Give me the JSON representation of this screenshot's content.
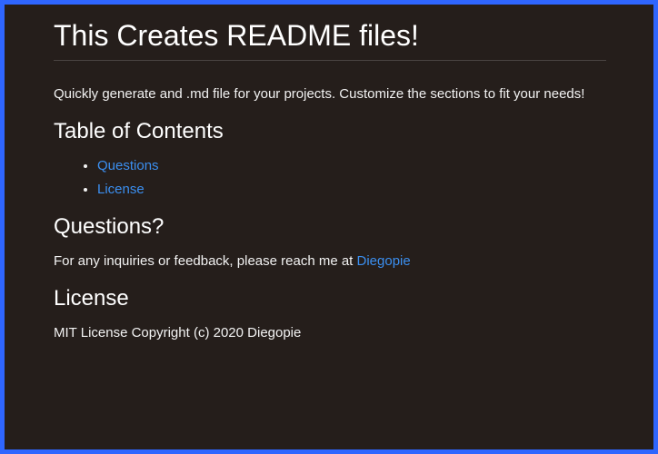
{
  "page": {
    "title": "This Creates README files!",
    "intro": "Quickly generate and .md file for your projects. Customize the sections to fit your needs!"
  },
  "toc": {
    "heading": "Table of Contents",
    "items": [
      {
        "label": "Questions"
      },
      {
        "label": "License"
      }
    ]
  },
  "questions": {
    "heading": "Questions?",
    "text": "For any inquiries or feedback, please reach me at ",
    "link_label": "Diegopie"
  },
  "license": {
    "heading": "License",
    "text": "MIT License Copyright (c) 2020 Diegopie"
  },
  "colors": {
    "border": "#2f66ff",
    "background": "#251e1b",
    "link": "#3b8ff0"
  }
}
